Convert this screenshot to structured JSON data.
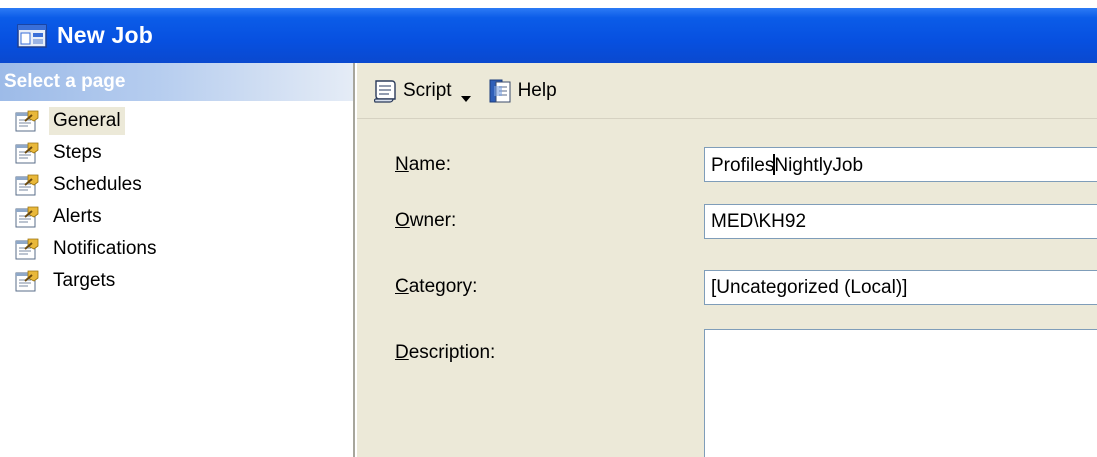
{
  "window": {
    "title": "New Job",
    "title_bar_color": "#0750e0"
  },
  "left_pane": {
    "header": "Select a page",
    "items": [
      {
        "label": "General",
        "selected": true,
        "icon": "page-properties-icon"
      },
      {
        "label": "Steps",
        "selected": false,
        "icon": "page-properties-icon"
      },
      {
        "label": "Schedules",
        "selected": false,
        "icon": "page-properties-icon"
      },
      {
        "label": "Alerts",
        "selected": false,
        "icon": "page-properties-icon"
      },
      {
        "label": "Notifications",
        "selected": false,
        "icon": "page-properties-icon"
      },
      {
        "label": "Targets",
        "selected": false,
        "icon": "page-properties-icon"
      }
    ]
  },
  "toolbar": {
    "script_label": "Script",
    "help_label": "Help"
  },
  "form": {
    "name": {
      "label_accel": "N",
      "label_rest": "ame:",
      "value": "ProfilesNightlyJob"
    },
    "owner": {
      "label_accel": "O",
      "label_rest": "wner:",
      "value": "MED\\KH92"
    },
    "category": {
      "label_accel": "C",
      "label_rest": "ategory:",
      "value": "[Uncategorized (Local)]"
    },
    "description": {
      "label_accel": "D",
      "label_rest": "escription:",
      "value": ""
    }
  }
}
